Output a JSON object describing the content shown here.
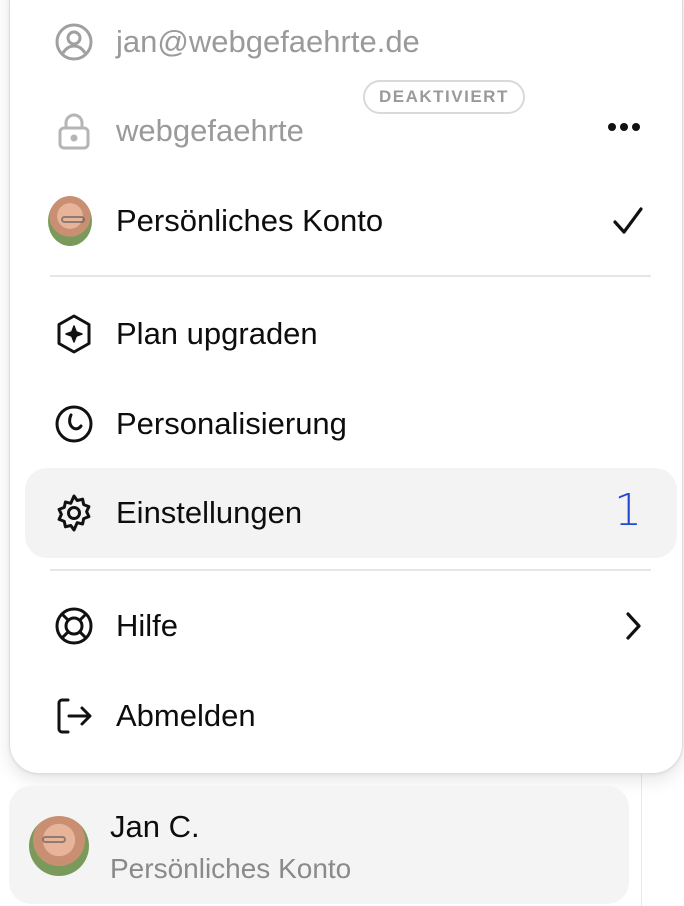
{
  "menu": {
    "email": "jan@webgefaehrte.de",
    "workspace": {
      "name": "webgefaehrte",
      "badge": "DEAKTIVIERT"
    },
    "personal_account": "Persönliches Konto",
    "items": [
      {
        "label": "Plan upgraden",
        "icon": "sparkle-hexagon-icon"
      },
      {
        "label": "Personalisierung",
        "icon": "personalization-icon"
      },
      {
        "label": "Einstellungen",
        "icon": "gear-icon"
      },
      {
        "label": "Hilfe",
        "icon": "lifebuoy-icon"
      },
      {
        "label": "Abmelden",
        "icon": "logout-icon"
      }
    ]
  },
  "annotation": {
    "text": "1",
    "color": "#2447d4"
  },
  "account": {
    "name": "Jan C.",
    "type": "Persönliches Konto"
  }
}
